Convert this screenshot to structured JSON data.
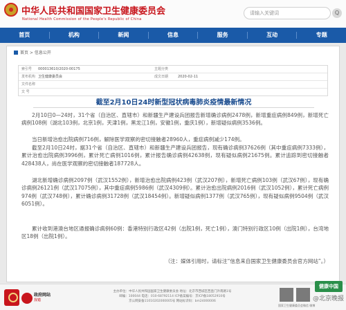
{
  "header": {
    "title_cn": "中华人民共和国国家卫生健康委员会",
    "title_en": "National Health Commission of the People's Republic of China",
    "search_placeholder": "请输入关键词",
    "search_button": "Q"
  },
  "nav": [
    "首页",
    "机构",
    "新闻",
    "信息",
    "服务",
    "互动",
    "专题"
  ],
  "breadcrumb": "首页 > 信息公开",
  "info": {
    "index_label": "索引号",
    "index_value": "000013610/2020-00175",
    "category_label": "主题分类",
    "category_value": "",
    "publisher_label": "发布机构",
    "publisher_value": "卫生健康委员会",
    "date_label": "成文日期",
    "date_value": "2020-02-11",
    "name_label": "文件名称",
    "name_value": "",
    "doc_label": "文  号",
    "doc_value": ""
  },
  "doc_title": "截至2月10日24时新型冠状病毒肺炎疫情最新情况",
  "paragraphs": [
    "2月10日0—24时，31个省（自治区、直辖市）和新疆生产建设兵团报告新增确诊病例2478例，新增重症病例849例，新增死亡病例108例（湖北103例，北京1例，天津1例，黑龙江1例，安徽1例，重庆1例），新增疑似病例3536例。",
    "当日新增治愈出院病例716例，解除医学观察的密切接触者28960人，重症病例减少174例。",
    "截至2月10日24时，据31个省（自治区、直辖市）和新疆生产建设兵团报告，现有确诊病例37626例（其中重症病例7333例），累计治愈出院病例3996例，累计死亡病例1016例，累计报告确诊病例42638例，现有疑似病例21675例。累计追踪到密切接触者428438人，尚在医学观察的密切接触者187728人。",
    "湖北新增确诊病例2097例（武汉1552例），新增治愈出院病例423例（武汉207例），新增死亡病例103例（武汉67例），现有确诊病例26121例（武汉17075例），其中重症病例5986例（武汉4309例）。累计治愈出院病例2016例（武汉1052例），累计死亡病例974例（武汉748例），累计确诊病例31728例（武汉18454例）。新增疑似病例1377例（武汉765例），现有疑似病例9504例（武汉6051例）。",
    "累计收到港澳台地区通报确诊病例60例：香港特别行政区42例（出院1例，死亡1例），澳门特别行政区10例（出院1例），台湾地区18例（出院1例）。",
    "（注：媒体引用时，请标注“信息来自国家卫生健康委员会官方网站”。）"
  ],
  "footer": {
    "badge_text": "",
    "logo_text": "政府网站",
    "logo_sub": "找错",
    "lines": [
      "主办单位：中华人民共和国国家卫生健康委员会  地址：北京市西城区西直门外南路1号",
      "邮编：100044  电话：010-68792114  ICP备案编号：京ICP备18052910号",
      "京公网安备11010202000005号  网站标识码：bm24000006"
    ],
    "qr_caption": "国家卫生健康委员会微信  微博",
    "jiankang_badge": "健康中国"
  },
  "watermark": "@北京晚报"
}
